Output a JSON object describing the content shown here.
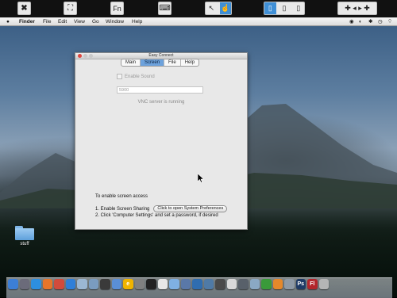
{
  "toolbar": {
    "buttons": [
      {
        "name": "close-remote-icon",
        "glyph": "✖"
      },
      {
        "name": "fullscreen-icon",
        "glyph": "⛶"
      },
      {
        "name": "fn-key-icon",
        "label": "Fn"
      },
      {
        "name": "keyboard-icon",
        "glyph": "⌨"
      },
      {
        "name": "pointer-mode-icon",
        "glyph": "↖"
      },
      {
        "name": "mouse-buttons-icon",
        "glyph": "🖱"
      },
      {
        "name": "gamepad-icon",
        "glyph": "✚"
      }
    ]
  },
  "menubar": {
    "apple": "",
    "app": "Finder",
    "items": [
      "File",
      "Edit",
      "View",
      "Go",
      "Window",
      "Help"
    ]
  },
  "window": {
    "title": "Easy Connect",
    "tabs": [
      "Main",
      "Screen",
      "File",
      "Help"
    ],
    "active_tab": "Screen",
    "enable_sound_label": "Enable Sound",
    "port_value": "5900",
    "vnc_status": "VNC server is running",
    "access_heading": "To enable screen access",
    "step1_text": "1.  Enable Screen Sharing",
    "step1_button": "Click to open System Preferences",
    "step2_text": "2.  Click 'Computer Settings' and set a password, if desired"
  },
  "desktop": {
    "folder_label": "stuff"
  },
  "dock": {
    "icons": [
      {
        "name": "finder-icon",
        "color": "#3c7fd6"
      },
      {
        "name": "launchpad-icon",
        "color": "#6b6b7a"
      },
      {
        "name": "safari-icon",
        "color": "#2d8fe0"
      },
      {
        "name": "firefox-icon",
        "color": "#e6752a"
      },
      {
        "name": "chrome-icon",
        "color": "#d24b3c"
      },
      {
        "name": "appstore-icon",
        "color": "#2f7fd8"
      },
      {
        "name": "mail-icon",
        "color": "#9bb7d3"
      },
      {
        "name": "mail-icon-2",
        "color": "#7a9cc0"
      },
      {
        "name": "facetime-icon",
        "color": "#3a3a3a"
      },
      {
        "name": "itunes-icon",
        "color": "#5a8fd6"
      },
      {
        "name": "ie-icon",
        "color": "#f0b400",
        "glyph": "e"
      },
      {
        "name": "system-prefs-icon",
        "color": "#808080"
      },
      {
        "name": "terminal-icon",
        "color": "#222222"
      },
      {
        "name": "ical-icon",
        "color": "#e8e8e8"
      },
      {
        "name": "messages-icon",
        "color": "#7fb0e3"
      },
      {
        "name": "preview-icon",
        "color": "#5a78a8"
      },
      {
        "name": "photos-icon",
        "color": "#2f6db0"
      },
      {
        "name": "iphoto-icon",
        "color": "#4f7aa6"
      },
      {
        "name": "xcode-icon",
        "color": "#4a4a4a"
      },
      {
        "name": "calendar-icon",
        "color": "#d9d9d9"
      },
      {
        "name": "timemachine-icon",
        "color": "#58606a"
      },
      {
        "name": "folder-dock-icon",
        "color": "#8aa8c4"
      },
      {
        "name": "utorrent-icon",
        "color": "#3a9a3a"
      },
      {
        "name": "vlc-icon",
        "color": "#e5882b"
      },
      {
        "name": "downloads-icon",
        "color": "#8f9aa6"
      },
      {
        "name": "photoshop-icon",
        "color": "#1f3b66",
        "glyph": "Ps"
      },
      {
        "name": "flash-icon",
        "color": "#b3262b",
        "glyph": "Fl"
      },
      {
        "name": "trash-icon",
        "color": "#b5b5b5"
      }
    ]
  }
}
